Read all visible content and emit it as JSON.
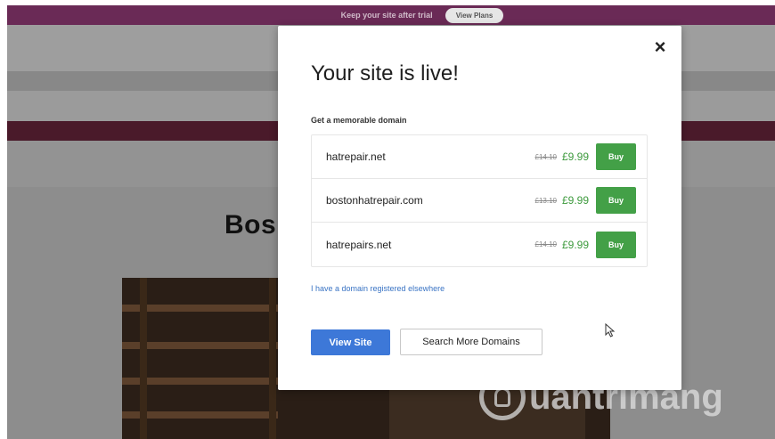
{
  "trial_bar": {
    "message": "Keep your site after trial",
    "view_plans_label": "View Plans"
  },
  "site": {
    "heading": "Bos"
  },
  "modal": {
    "close_symbol": "×",
    "title": "Your site is live!",
    "domain_subtitle": "Get a memorable domain",
    "domains": [
      {
        "name": "hatrepair.net",
        "old_price": "£14.10",
        "price": "£9.99",
        "buy_label": "Buy"
      },
      {
        "name": "bostonhatrepair.com",
        "old_price": "£13.10",
        "price": "£9.99",
        "buy_label": "Buy"
      },
      {
        "name": "hatrepairs.net",
        "old_price": "£14.10",
        "price": "£9.99",
        "buy_label": "Buy"
      }
    ],
    "elsewhere_link": "I have a domain registered elsewhere",
    "view_site_label": "View Site",
    "search_more_label": "Search More Domains"
  },
  "watermark": {
    "text": "uantrimang"
  },
  "colors": {
    "trial_bar": "#6a2a56",
    "buy_green": "#43a047",
    "price_green": "#3d9a3d",
    "primary_blue": "#3d78d8",
    "link_blue": "#3a74c4"
  },
  "icons": {
    "close": "close-icon",
    "cursor": "mouse-pointer-icon",
    "watermark_logo": "lightbulb-icon"
  }
}
